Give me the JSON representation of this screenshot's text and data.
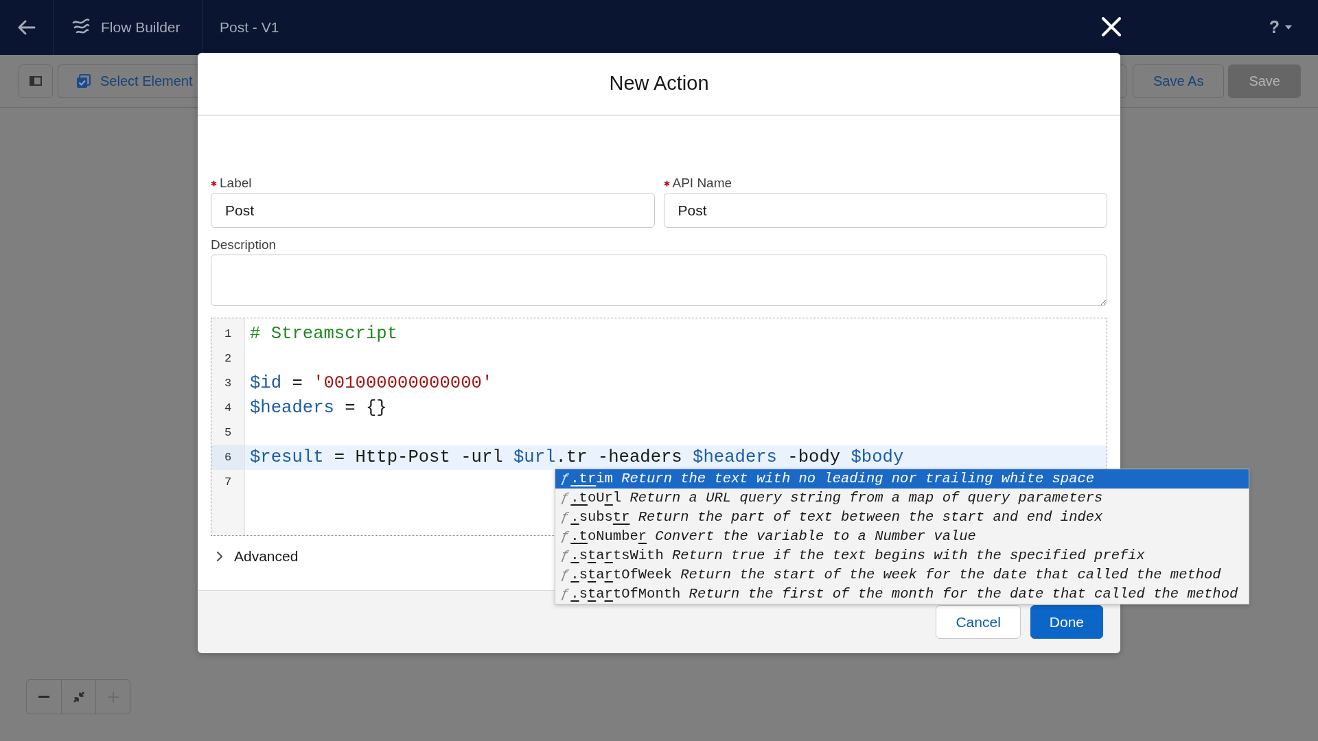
{
  "top_bar": {
    "app_name": "Flow Builder",
    "flow_name": "Post - V1",
    "help_label": "?"
  },
  "toolbar": {
    "select_button": {
      "label": "Select Element"
    },
    "buttons": [
      {
        "label": "Save As",
        "disabled": false
      },
      {
        "label": "Save",
        "disabled": true
      }
    ]
  },
  "modal": {
    "title": "New Action",
    "fields": [
      {
        "label": "Label",
        "required": true,
        "value": "Post"
      },
      {
        "label": "API Name",
        "required": true,
        "value": "Post"
      }
    ],
    "description": {
      "label": "Description",
      "required": false
    },
    "editor": {
      "lines": [
        {
          "number": "1",
          "current": false,
          "tokens": [
            {
              "kind": "comment",
              "text": "# Streamscript"
            }
          ]
        },
        {
          "number": "2",
          "current": false
        },
        {
          "number": "3",
          "current": false,
          "tokens": [
            {
              "kind": "variable",
              "text": "$id"
            },
            {
              "kind": "plain",
              "text": " = "
            },
            {
              "kind": "string",
              "text": "'001000000000000'"
            }
          ]
        },
        {
          "number": "4",
          "current": false,
          "tokens": [
            {
              "kind": "variable",
              "text": "$headers"
            },
            {
              "kind": "plain",
              "text": " = {}"
            }
          ]
        },
        {
          "number": "5",
          "current": false
        },
        {
          "number": "6",
          "current": true,
          "tokens": [
            {
              "kind": "variable",
              "text": "$result"
            },
            {
              "kind": "plain",
              "text": " = Http-Post -url "
            },
            {
              "kind": "variable",
              "text": "$url"
            },
            {
              "kind": "plain",
              "text": ".tr -headers "
            },
            {
              "kind": "variable",
              "text": "$headers"
            },
            {
              "kind": "plain",
              "text": " -body "
            },
            {
              "kind": "variable",
              "text": "$body"
            }
          ]
        },
        {
          "number": "7",
          "current": false
        }
      ]
    },
    "advanced": {
      "label": "Advanced",
      "expanded": false
    },
    "footer_buttons": [
      {
        "label": "Cancel",
        "kind": "neutral"
      },
      {
        "label": "Done",
        "kind": "brand"
      }
    ]
  },
  "autocomplete": {
    "items": [
      {
        "icon": "ƒ",
        "selected": true,
        "name_parts": [
          {
            "text": ".tr",
            "matched": true
          },
          {
            "text": "im",
            "matched": false
          }
        ],
        "description": "Return the text with no leading nor trailing white space"
      },
      {
        "icon": "ƒ",
        "selected": false,
        "name_parts": [
          {
            "text": ".t",
            "matched": true
          },
          {
            "text": "oU",
            "matched": false
          },
          {
            "text": "r",
            "matched": true
          },
          {
            "text": "l",
            "matched": false
          }
        ],
        "description": "Return a URL query string from a map of query parameters"
      },
      {
        "icon": "ƒ",
        "selected": false,
        "name_parts": [
          {
            "text": ".",
            "matched": true
          },
          {
            "text": "subs",
            "matched": false
          },
          {
            "text": "tr",
            "matched": true
          }
        ],
        "description": "Return the part of text between the start and end index"
      },
      {
        "icon": "ƒ",
        "selected": false,
        "name_parts": [
          {
            "text": ".t",
            "matched": true
          },
          {
            "text": "oNumbe",
            "matched": false
          },
          {
            "text": "r",
            "matched": true
          }
        ],
        "description": "Convert the variable to a Number value"
      },
      {
        "icon": "ƒ",
        "selected": false,
        "name_parts": [
          {
            "text": ".",
            "matched": true
          },
          {
            "text": "s",
            "matched": false
          },
          {
            "text": "t",
            "matched": true
          },
          {
            "text": "a",
            "matched": false
          },
          {
            "text": "r",
            "matched": true
          },
          {
            "text": "tsWith",
            "matched": false
          }
        ],
        "description": "Return true if the text begins with the specified prefix"
      },
      {
        "icon": "ƒ",
        "selected": false,
        "name_parts": [
          {
            "text": ".",
            "matched": true
          },
          {
            "text": "s",
            "matched": false
          },
          {
            "text": "t",
            "matched": true
          },
          {
            "text": "a",
            "matched": false
          },
          {
            "text": "r",
            "matched": true
          },
          {
            "text": "tOfWeek",
            "matched": false
          }
        ],
        "description": "Return the start of the week for the date that called the method"
      },
      {
        "icon": "ƒ",
        "selected": false,
        "name_parts": [
          {
            "text": ".",
            "matched": true
          },
          {
            "text": "s",
            "matched": false
          },
          {
            "text": "t",
            "matched": true
          },
          {
            "text": "a",
            "matched": false
          },
          {
            "text": "r",
            "matched": true
          },
          {
            "text": "tOfMonth",
            "matched": false
          }
        ],
        "description": "Return the first of the month for the date that called the method"
      }
    ]
  },
  "zoom_controls": [
    {
      "kind": "zoom-out",
      "disabled": false
    },
    {
      "kind": "fit",
      "disabled": false
    },
    {
      "kind": "zoom-in",
      "disabled": true
    }
  ]
}
